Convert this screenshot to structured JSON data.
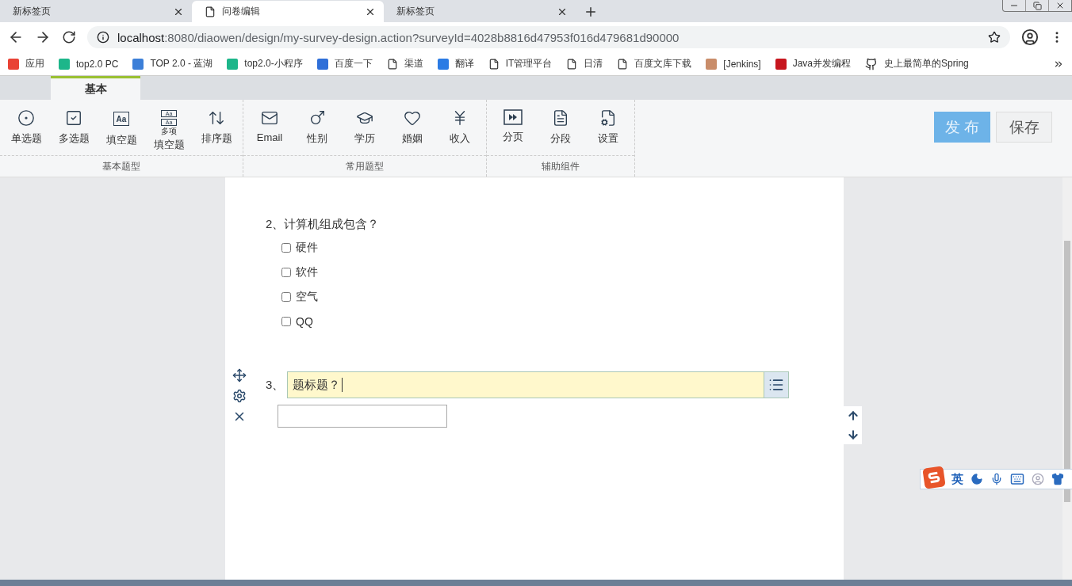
{
  "browser_tabs": [
    {
      "title": "新标签页",
      "selected": false
    },
    {
      "title": "问卷编辑",
      "selected": true
    },
    {
      "title": "新标签页",
      "selected": false
    }
  ],
  "address": {
    "host": "localhost",
    "path": ":8080/diaowen/design/my-survey-design.action?surveyId=4028b8816d47953f016d479681d90000"
  },
  "bookmarks": [
    "应用",
    "top2.0 PC",
    "TOP 2.0 - 蓝湖",
    "top2.0-小程序",
    "百度一下",
    "渠道",
    "翻译",
    "IT管理平台",
    "日清",
    "百度文库下载",
    "[Jenkins]",
    "Java并发编程",
    "史上最简单的Spring"
  ],
  "ribbon_tabs": [
    {
      "label": "基本",
      "selected": true
    }
  ],
  "ribbon_groups": [
    {
      "label": "基本题型",
      "items": [
        {
          "label": "单选题"
        },
        {
          "label": "多选题"
        },
        {
          "label": "填空题",
          "glyph": "Aa"
        },
        {
          "label": "填空题",
          "glyphs": [
            "Aa",
            "Aa"
          ],
          "badge": "多项"
        },
        {
          "label": "排序题"
        }
      ]
    },
    {
      "label": "常用题型",
      "items": [
        {
          "label": "Email"
        },
        {
          "label": "性别"
        },
        {
          "label": "学历"
        },
        {
          "label": "婚姻"
        },
        {
          "label": "收入"
        }
      ]
    },
    {
      "label": "辅助组件",
      "items": [
        {
          "label": "分页"
        },
        {
          "label": "分段"
        },
        {
          "label": "设置"
        }
      ]
    }
  ],
  "actions": [
    {
      "label": "发 布",
      "kind": "primary"
    },
    {
      "label": "保存",
      "kind": "default"
    }
  ],
  "questions": [
    {
      "kind": "checkbox",
      "number": "2、",
      "title": "计算机组成包含？",
      "options": [
        {
          "label": "硬件",
          "checked": false
        },
        {
          "label": "软件",
          "checked": false
        },
        {
          "label": "空气",
          "checked": false
        },
        {
          "label": "QQ",
          "checked": false
        }
      ]
    },
    {
      "kind": "fill",
      "number": "3、",
      "title": "题标题？",
      "editing": true
    }
  ],
  "ime": {
    "mode": "英"
  }
}
